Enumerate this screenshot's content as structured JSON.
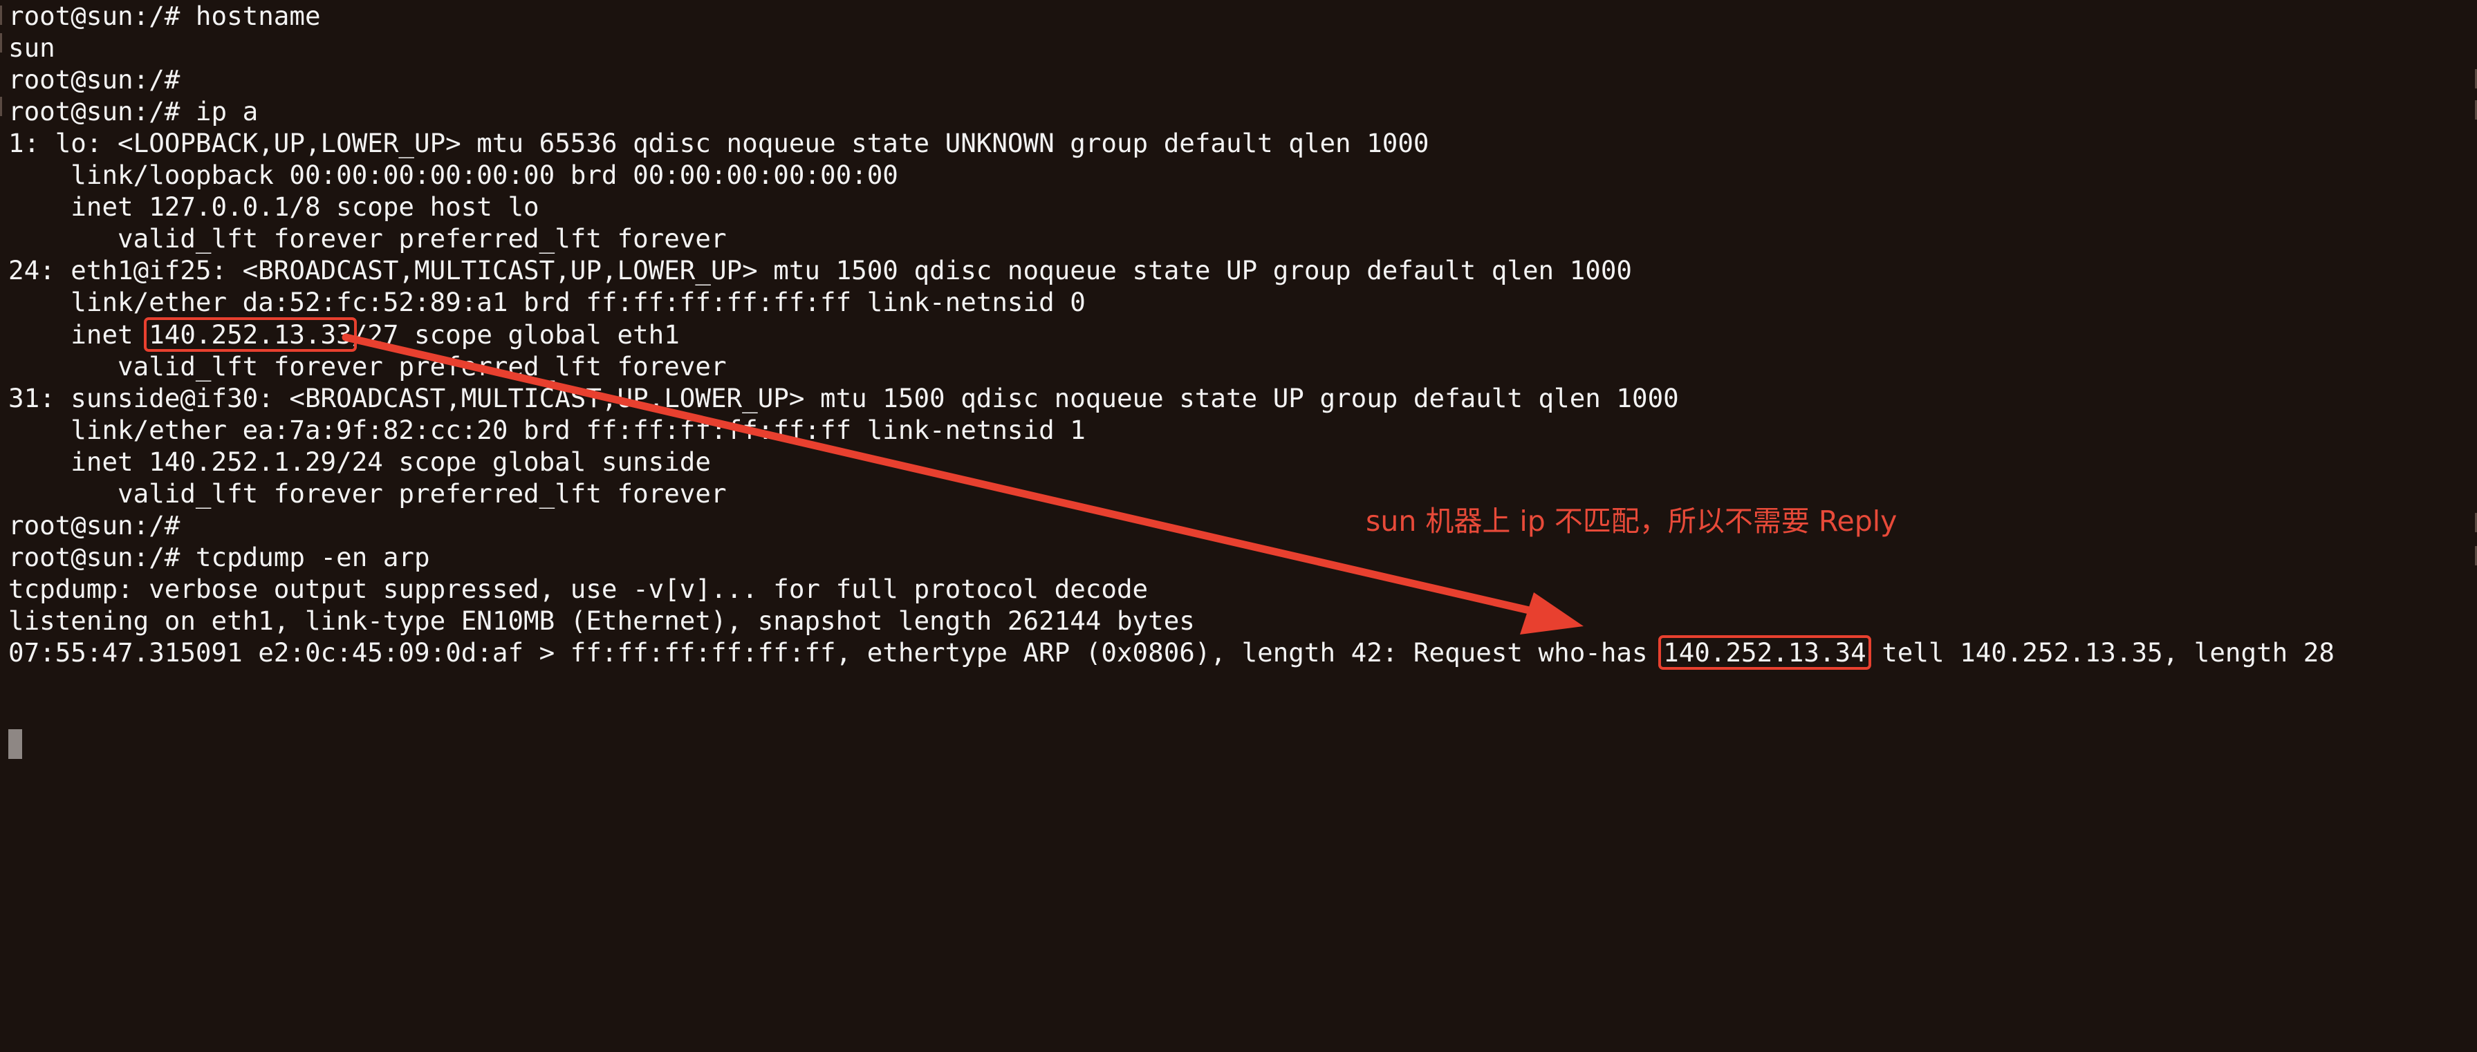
{
  "terminal": {
    "lines": [
      {
        "segments": [
          "root@sun:/# hostname"
        ]
      },
      {
        "segments": [
          "sun"
        ]
      },
      {
        "segments": [
          "root@sun:/#"
        ]
      },
      {
        "segments": [
          "root@sun:/# ip a"
        ]
      },
      {
        "segments": [
          "1: lo: <LOOPBACK,UP,LOWER_UP> mtu 65536 qdisc noqueue state UNKNOWN group default qlen 1000"
        ]
      },
      {
        "segments": [
          "    link/loopback 00:00:00:00:00:00 brd 00:00:00:00:00:00"
        ]
      },
      {
        "segments": [
          "    inet 127.0.0.1/8 scope host lo"
        ]
      },
      {
        "segments": [
          "       valid_lft forever preferred_lft forever"
        ]
      },
      {
        "segments": [
          "24: eth1@if25: <BROADCAST,MULTICAST,UP,LOWER_UP> mtu 1500 qdisc noqueue state UP group default qlen 1000"
        ]
      },
      {
        "segments": [
          "    link/ether da:52:fc:52:89:a1 brd ff:ff:ff:ff:ff:ff link-netnsid 0"
        ]
      },
      {
        "segments": [
          "    inet ",
          "140.252.13.33",
          "/27 scope global eth1"
        ]
      },
      {
        "segments": [
          "       valid_lft forever preferred_lft forever"
        ]
      },
      {
        "segments": [
          "31: sunside@if30: <BROADCAST,MULTICAST,UP,LOWER_UP> mtu 1500 qdisc noqueue state UP group default qlen 1000"
        ]
      },
      {
        "segments": [
          "    link/ether ea:7a:9f:82:cc:20 brd ff:ff:ff:ff:ff:ff link-netnsid 1"
        ]
      },
      {
        "segments": [
          "    inet 140.252.1.29/24 scope global sunside"
        ]
      },
      {
        "segments": [
          "       valid_lft forever preferred_lft forever"
        ]
      },
      {
        "segments": [
          "root@sun:/#"
        ]
      },
      {
        "segments": [
          "root@sun:/# tcpdump -en arp"
        ]
      },
      {
        "segments": [
          "tcpdump: verbose output suppressed, use -v[v]... for full protocol decode"
        ]
      },
      {
        "segments": [
          "listening on eth1, link-type EN10MB (Ethernet), snapshot length 262144 bytes"
        ]
      },
      {
        "segments": [
          "07:55:47.315091 e2:0c:45:09:0d:af > ff:ff:ff:ff:ff:ff, ethertype ARP (0x0806), length 42: Request who-has ",
          "140.252.13.34",
          " tell 140.252.13.35, length 28"
        ]
      }
    ]
  },
  "annotation": {
    "text": "sun 机器上 ip 不匹配，所以不需要 Reply",
    "color": "#e84a39"
  },
  "colors": {
    "background": "#1b120e",
    "text": "#f3f3f3",
    "highlight": "#e8402f",
    "cursor": "#8e8784"
  }
}
